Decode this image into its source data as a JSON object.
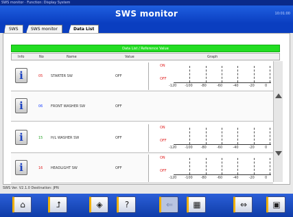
{
  "window": {
    "title": "SWS monitor · Function: Display System"
  },
  "header": {
    "title": "SWS monitor",
    "right": "10:01:00"
  },
  "breadcrumb": [
    "SWS",
    "SWS monitor",
    "Data List"
  ],
  "banner": "Data List / Reference Value",
  "columns": {
    "info": "Info",
    "no": "No",
    "name": "Name",
    "value": "Value",
    "graph": "Graph"
  },
  "rows": [
    {
      "no": "05",
      "no_color": "#e02020",
      "name": "STARTER SW",
      "value": "OFF",
      "graph": true,
      "on_label": "ON",
      "off_label": "OFF",
      "ticks": [
        "-120",
        "-100",
        "-80",
        "-60",
        "-40",
        "-20",
        "0"
      ]
    },
    {
      "no": "06",
      "no_color": "#1a40ff",
      "name": "FRONT WASHER SW",
      "value": "OFF",
      "graph": false
    },
    {
      "no": "15",
      "no_color": "#20a020",
      "name": "H/L WASHER SW",
      "value": "OFF",
      "graph": true,
      "on_label": "ON",
      "off_label": "OFF",
      "ticks": [
        "-120",
        "-100",
        "-80",
        "-60",
        "-40",
        "-20",
        "0"
      ]
    },
    {
      "no": "16",
      "no_color": "#e02020",
      "name": "HEADLIGHT SW",
      "value": "OFF",
      "graph": true,
      "on_label": "ON",
      "off_label": "OFF",
      "ticks": [
        "-120",
        "-100",
        "-80",
        "-60",
        "-40",
        "-20",
        "0"
      ]
    }
  ],
  "status": "SWS Ver. V2.1.0 Destination: JPN",
  "toolbar": {
    "items": [
      {
        "icon": "⌂",
        "name": "home"
      },
      {
        "icon": "⮥",
        "name": "back"
      },
      {
        "icon": "◈",
        "name": "capture"
      },
      {
        "icon": "?",
        "name": "help"
      },
      {
        "icon": "⇐",
        "name": "prev-page"
      },
      {
        "icon": "▦",
        "name": "table-view"
      },
      {
        "icon": "⇔",
        "name": "graph-toggle"
      },
      {
        "icon": "▣",
        "name": "screen"
      }
    ]
  }
}
